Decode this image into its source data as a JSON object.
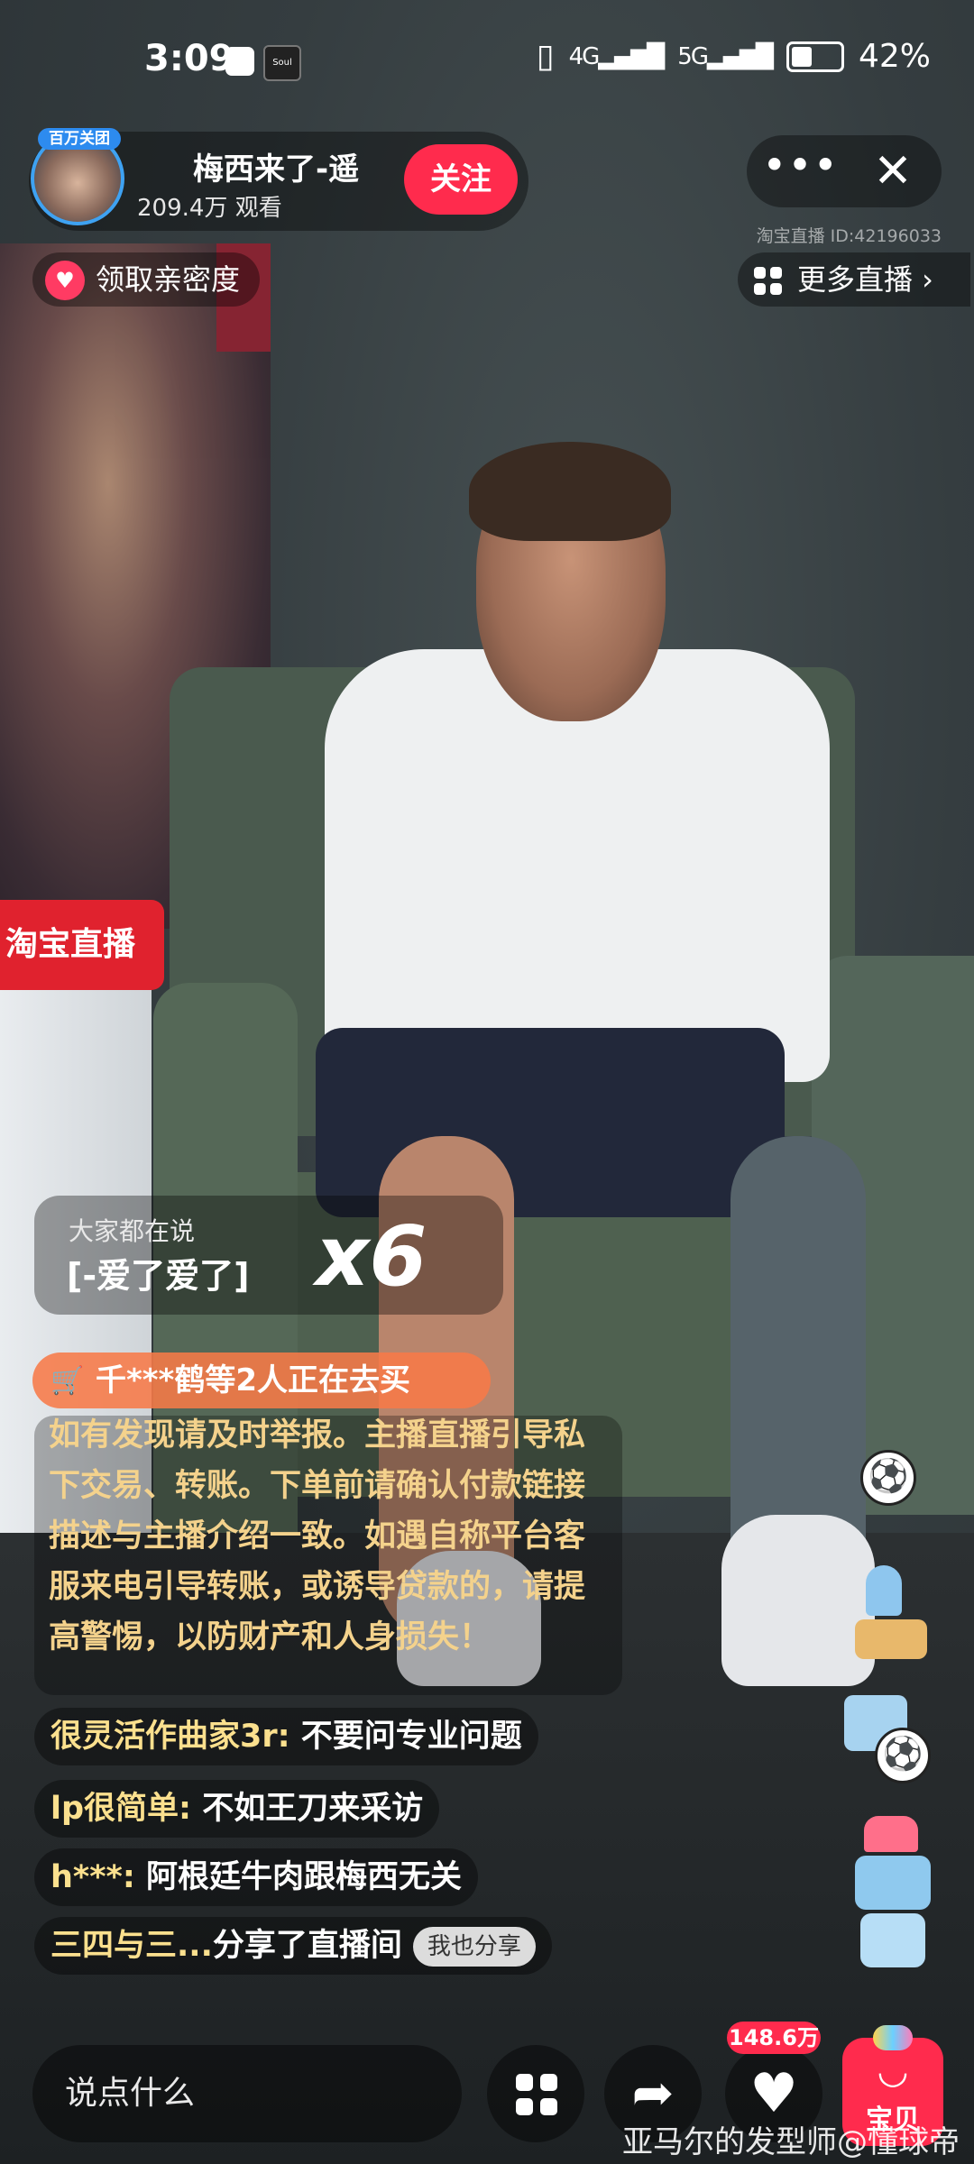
{
  "status_bar": {
    "time": "3:09",
    "app_icon_2_text": "Soul",
    "network_1": "4G",
    "network_2": "5G",
    "battery": "42%"
  },
  "host": {
    "avatar_tag": "百万关团",
    "name": "梅西来了-遥",
    "views": "209.4万 观看",
    "follow_label": "关注"
  },
  "top_controls": {
    "more_label": "•••",
    "close_label": "✕",
    "room_id": "淘宝直播 ID:42196033",
    "more_live_label": "更多直播 ›",
    "intimacy_label": "领取亲密度"
  },
  "video": {
    "sign_text": "淘宝直播"
  },
  "hot_card": {
    "title": "大家都在说",
    "text": "[-爱了爱了]",
    "count": "x6"
  },
  "buying": {
    "text": "千***鹤等2人正在去买"
  },
  "notice": {
    "text": "如有发现请及时举报。主播直播引导私下交易、转账。下单前请确认付款链接描述与主播介绍一致。如遇自称平台客服来电引导转账，或诱导贷款的，请提高警惕，以防财产和人身损失！"
  },
  "comments": [
    {
      "user": "很灵活作曲家3r: ",
      "text": "不要问专业问题"
    },
    {
      "user": "lp很简单: ",
      "text": "不如王刀来采访"
    },
    {
      "user": "h***: ",
      "text": "阿根廷牛肉跟梅西无关"
    },
    {
      "user": "三四与三...",
      "text": "分享了直播间",
      "tag": "我也分享"
    }
  ],
  "bottom_bar": {
    "input_placeholder": "说点什么",
    "likes": "148.6万",
    "cart_label": "宝贝",
    "watermark": "亚马尔的发型师@懂球帝"
  },
  "icons": {
    "more": "more-icon",
    "close": "close-icon",
    "heart": "heart-icon",
    "grid": "grid-icon",
    "cart": "cart-icon",
    "share": "share-icon",
    "soccer": "soccer-ball-icon"
  },
  "colors": {
    "accent": "#ff2b4d",
    "notice_text": "#f4d28c",
    "buying_bg": "#f77a48",
    "avatar_ring": "#3ea2f2"
  }
}
